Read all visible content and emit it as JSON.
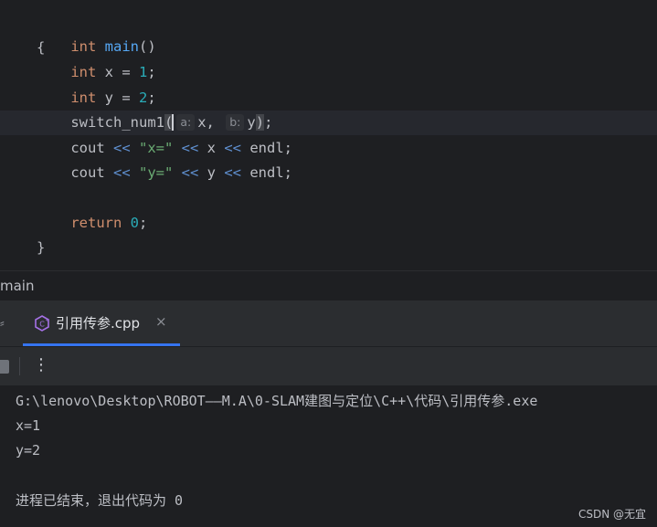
{
  "editor": {
    "lines": {
      "l1": {
        "kw": "int",
        "fn": "main",
        "rest": "()"
      },
      "l2": "{",
      "l3": {
        "kw": "int",
        "mid": " x = ",
        "num": "1",
        "end": ";"
      },
      "l4": {
        "kw": "int",
        "mid": " y = ",
        "num": "2",
        "end": ";"
      },
      "l5": {
        "name": "switch_num1",
        "open": "(",
        "hint_a": "a:",
        "arg1": "x,",
        "hint_b": "b:",
        "arg2": "y",
        "close": ")",
        "end": ";"
      },
      "l6": {
        "a": "cout ",
        "op1": "<<",
        "str": " \"x=\" ",
        "op2": "<<",
        "var": " x ",
        "op3": "<<",
        "end": " endl;"
      },
      "l7": {
        "a": "cout ",
        "op1": "<<",
        "str": " \"y=\" ",
        "op2": "<<",
        "var": " y ",
        "op3": "<<",
        "end": " endl;"
      },
      "l9": {
        "kw": "return",
        "sp": " ",
        "num": "0",
        "end": ";"
      },
      "l10": "}"
    }
  },
  "breadcrumb": {
    "label": "main"
  },
  "run_panel": {
    "tab": {
      "label": "引用传参.cpp",
      "close": "×",
      "icon": "cpp-file-icon"
    },
    "toolbar": {
      "more": "⋮"
    },
    "console": {
      "path": "G:\\lenovo\\Desktop\\ROBOT——M.A\\0-SLAM建图与定位\\C++\\代码\\引用传参.exe",
      "out1": "x=1",
      "out2": "y=2",
      "exit": "进程已结束，退出代码为 0"
    }
  },
  "watermark": "CSDN @无宜",
  "colors": {
    "keyword": "#cf8e6d",
    "function": "#56a8f5",
    "number": "#2aacb8",
    "string": "#6aab73",
    "operator": "#5f8fcf",
    "accent": "#3574f0"
  }
}
